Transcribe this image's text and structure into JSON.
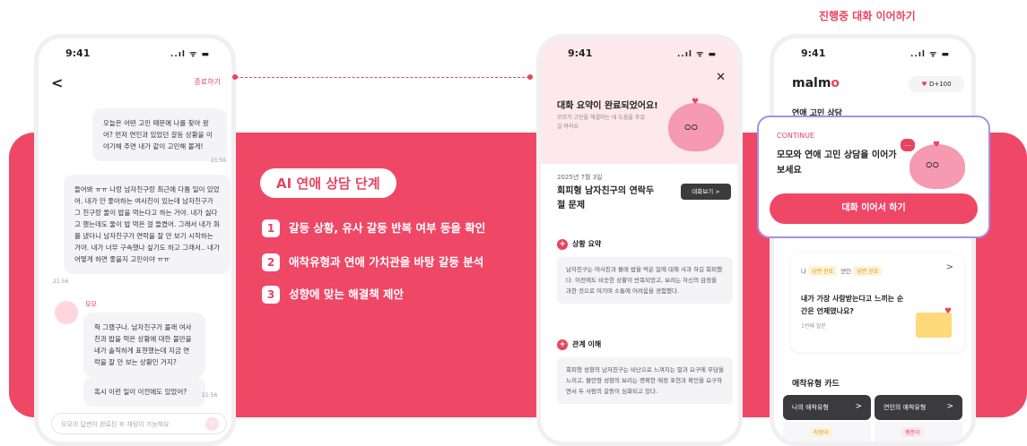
{
  "top_caption": "진행중 대화 이어하기",
  "stage": {
    "title": "AI 연애 상담 단계",
    "steps": [
      {
        "num": "1",
        "text": "갈등 상황, 유사 갈등 반복 여부 등을 확인"
      },
      {
        "num": "2",
        "text": "애착유형과 연애 가치관을 바탕 갈등 분석"
      },
      {
        "num": "3",
        "text": "성향에 맞는 해결책 제안"
      }
    ]
  },
  "status": {
    "time": "9:41",
    "icons": "..ıl ᯤ ▬"
  },
  "phone1": {
    "end_label": "종료하기",
    "messages": [
      {
        "text": "오늘은 어떤 고민 때문에 나를 찾아 왔어? 먼저 연인과 있었던 갈등 상황을 이야기해 주면 내가 같이 고민해 볼게!",
        "time": "21:56"
      },
      {
        "text": "들어봐 ㅠㅠ 나랑 남자친구랑 최근에 다툼 일이 있었어. 내가 안 좋아하는 여사친이 있는데 남자친구가 그 친구랑 둘이 밥을 먹는다고 하는 거야. 내가 싫다고 했는데도 둘이 밥 먹은 걸 들켰어. 그래서 내가 화를 냈더니 남자친구가 연락을 잘 안 보기 시작하는 거야. 내가 너무 구속했나 싶기도 하고 그래서.. 내가 어떻게 하면 좋을지 고민이야 ㅠㅠ",
        "time": "21:56"
      },
      {
        "text": "헉 그랬구나. 남자친구가 몰래 여사친과 밥을 먹은 상황에 대한 불만을 네가 솔직하게 표현했는데 지금 연락을 잘 안 보는 상황인 거지?",
        "time": ""
      },
      {
        "text": "혹시 이런 일이 이전에도 있었어?",
        "time": "21:56"
      }
    ],
    "momo_name": "모모",
    "input_placeholder": "모모의 답변이 완료된 후 채팅이 가능해요"
  },
  "phone2": {
    "header": "대화 요약이 완료되었어요!",
    "subtext": "모모가 고민을 해결하는 데 도움을 주었길 바라요",
    "date": "2025년 7월 3일",
    "title": "회피형 남자친구의 연락두절 문제",
    "view_button": "대화보기 >",
    "sections": [
      {
        "title": "상황 요약",
        "text": "남자친구는 여사친과 몰래 밥을 먹은 일에 대해 사과 하길 회피했다. 이전에도 비슷한 상황이 반복되었고, 보려는 자신의 감정을 과한 것으로 여기며 소통에 어려움을 경험했다."
      },
      {
        "title": "관계 이해",
        "text": "회피형 성향의 남자친구는 비난으로 느껴지는 말과 요구에 부담을 느끼고, 불안형 성향의 보리는 명확한 애정 표현과 확인을 요구하면서 두 사람의 갈등이 심화되고 있다."
      }
    ]
  },
  "phone3": {
    "logo_pre": "malm",
    "logo_post": "o",
    "dday": "D+100",
    "heading": "연애 고민 상담",
    "continue_label": "CONTINUE",
    "continue_text": "모모와 연애 고민 상담을 이어가 보세요",
    "continue_button": "대화 이어서 하기",
    "qa_me": "나",
    "qa_me_tag": "답변 완료",
    "qa_partner": "연인",
    "qa_partner_tag": "답변 완료",
    "question": "내가 가장 사랑받는다고 느끼는 순간은 언제였나요?",
    "question_no": "1번째 질문",
    "types_heading": "애착유형 카드",
    "type_cards": [
      {
        "label": "나의 애착유형",
        "tag": "러정이"
      },
      {
        "label": "연인의 애착유형",
        "tag": "팽준이"
      }
    ]
  }
}
